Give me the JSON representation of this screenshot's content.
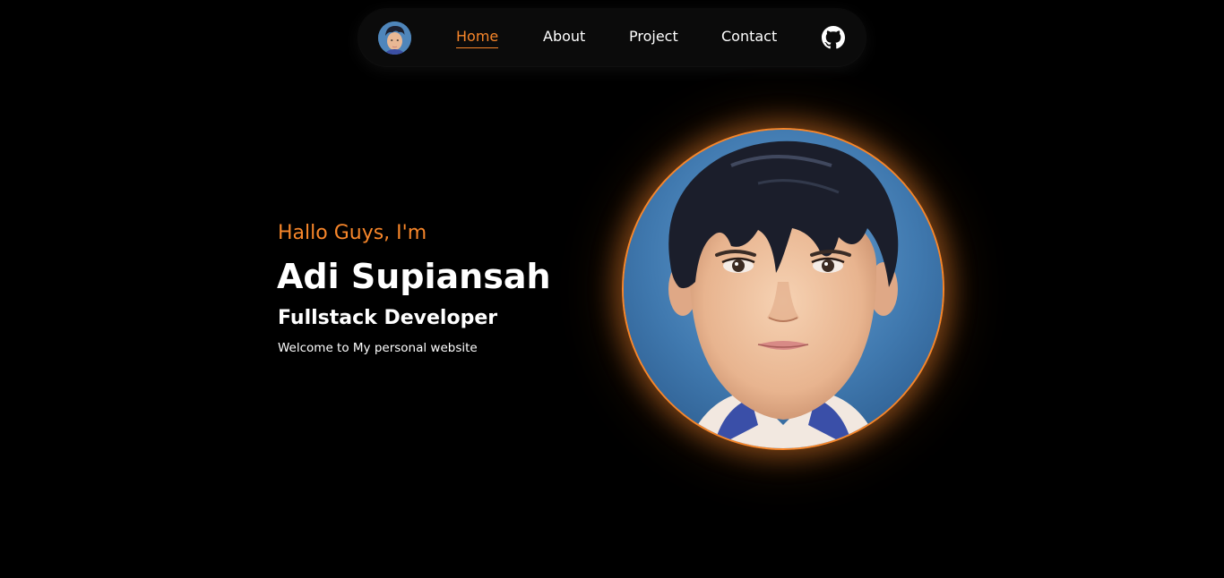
{
  "colors": {
    "accent": "#f7862a",
    "background": "#000000",
    "nav_background": "#0b0b0b",
    "text": "#ffffff"
  },
  "navbar": {
    "avatar_icon": "avatar-icon",
    "links": [
      {
        "label": "Home",
        "active": true
      },
      {
        "label": "About",
        "active": false
      },
      {
        "label": "Project",
        "active": false
      },
      {
        "label": "Contact",
        "active": false
      }
    ],
    "github_icon": "github-icon"
  },
  "hero": {
    "greeting": "Hallo Guys, I'm",
    "name": "Adi Supiansah",
    "role": "Fullstack Developer",
    "welcome": "Welcome to My personal website",
    "portrait_icon": "portrait-illustration"
  }
}
